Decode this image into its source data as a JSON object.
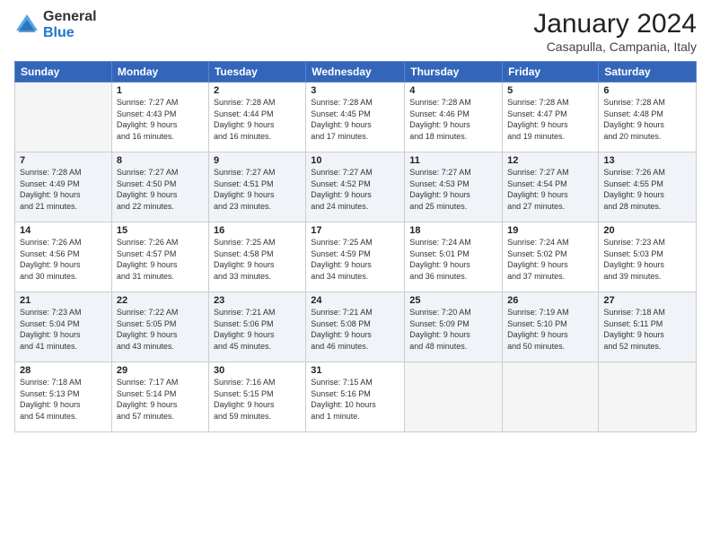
{
  "logo": {
    "general": "General",
    "blue": "Blue"
  },
  "header": {
    "month": "January 2024",
    "location": "Casapulla, Campania, Italy"
  },
  "weekdays": [
    "Sunday",
    "Monday",
    "Tuesday",
    "Wednesday",
    "Thursday",
    "Friday",
    "Saturday"
  ],
  "weeks": [
    [
      {
        "day": "",
        "sunrise": "",
        "sunset": "",
        "daylight": ""
      },
      {
        "day": "1",
        "sunrise": "Sunrise: 7:27 AM",
        "sunset": "Sunset: 4:43 PM",
        "daylight": "Daylight: 9 hours and 16 minutes."
      },
      {
        "day": "2",
        "sunrise": "Sunrise: 7:28 AM",
        "sunset": "Sunset: 4:44 PM",
        "daylight": "Daylight: 9 hours and 16 minutes."
      },
      {
        "day": "3",
        "sunrise": "Sunrise: 7:28 AM",
        "sunset": "Sunset: 4:45 PM",
        "daylight": "Daylight: 9 hours and 17 minutes."
      },
      {
        "day": "4",
        "sunrise": "Sunrise: 7:28 AM",
        "sunset": "Sunset: 4:46 PM",
        "daylight": "Daylight: 9 hours and 18 minutes."
      },
      {
        "day": "5",
        "sunrise": "Sunrise: 7:28 AM",
        "sunset": "Sunset: 4:47 PM",
        "daylight": "Daylight: 9 hours and 19 minutes."
      },
      {
        "day": "6",
        "sunrise": "Sunrise: 7:28 AM",
        "sunset": "Sunset: 4:48 PM",
        "daylight": "Daylight: 9 hours and 20 minutes."
      }
    ],
    [
      {
        "day": "7",
        "sunrise": "Sunrise: 7:28 AM",
        "sunset": "Sunset: 4:49 PM",
        "daylight": "Daylight: 9 hours and 21 minutes."
      },
      {
        "day": "8",
        "sunrise": "Sunrise: 7:27 AM",
        "sunset": "Sunset: 4:50 PM",
        "daylight": "Daylight: 9 hours and 22 minutes."
      },
      {
        "day": "9",
        "sunrise": "Sunrise: 7:27 AM",
        "sunset": "Sunset: 4:51 PM",
        "daylight": "Daylight: 9 hours and 23 minutes."
      },
      {
        "day": "10",
        "sunrise": "Sunrise: 7:27 AM",
        "sunset": "Sunset: 4:52 PM",
        "daylight": "Daylight: 9 hours and 24 minutes."
      },
      {
        "day": "11",
        "sunrise": "Sunrise: 7:27 AM",
        "sunset": "Sunset: 4:53 PM",
        "daylight": "Daylight: 9 hours and 25 minutes."
      },
      {
        "day": "12",
        "sunrise": "Sunrise: 7:27 AM",
        "sunset": "Sunset: 4:54 PM",
        "daylight": "Daylight: 9 hours and 27 minutes."
      },
      {
        "day": "13",
        "sunrise": "Sunrise: 7:26 AM",
        "sunset": "Sunset: 4:55 PM",
        "daylight": "Daylight: 9 hours and 28 minutes."
      }
    ],
    [
      {
        "day": "14",
        "sunrise": "Sunrise: 7:26 AM",
        "sunset": "Sunset: 4:56 PM",
        "daylight": "Daylight: 9 hours and 30 minutes."
      },
      {
        "day": "15",
        "sunrise": "Sunrise: 7:26 AM",
        "sunset": "Sunset: 4:57 PM",
        "daylight": "Daylight: 9 hours and 31 minutes."
      },
      {
        "day": "16",
        "sunrise": "Sunrise: 7:25 AM",
        "sunset": "Sunset: 4:58 PM",
        "daylight": "Daylight: 9 hours and 33 minutes."
      },
      {
        "day": "17",
        "sunrise": "Sunrise: 7:25 AM",
        "sunset": "Sunset: 4:59 PM",
        "daylight": "Daylight: 9 hours and 34 minutes."
      },
      {
        "day": "18",
        "sunrise": "Sunrise: 7:24 AM",
        "sunset": "Sunset: 5:01 PM",
        "daylight": "Daylight: 9 hours and 36 minutes."
      },
      {
        "day": "19",
        "sunrise": "Sunrise: 7:24 AM",
        "sunset": "Sunset: 5:02 PM",
        "daylight": "Daylight: 9 hours and 37 minutes."
      },
      {
        "day": "20",
        "sunrise": "Sunrise: 7:23 AM",
        "sunset": "Sunset: 5:03 PM",
        "daylight": "Daylight: 9 hours and 39 minutes."
      }
    ],
    [
      {
        "day": "21",
        "sunrise": "Sunrise: 7:23 AM",
        "sunset": "Sunset: 5:04 PM",
        "daylight": "Daylight: 9 hours and 41 minutes."
      },
      {
        "day": "22",
        "sunrise": "Sunrise: 7:22 AM",
        "sunset": "Sunset: 5:05 PM",
        "daylight": "Daylight: 9 hours and 43 minutes."
      },
      {
        "day": "23",
        "sunrise": "Sunrise: 7:21 AM",
        "sunset": "Sunset: 5:06 PM",
        "daylight": "Daylight: 9 hours and 45 minutes."
      },
      {
        "day": "24",
        "sunrise": "Sunrise: 7:21 AM",
        "sunset": "Sunset: 5:08 PM",
        "daylight": "Daylight: 9 hours and 46 minutes."
      },
      {
        "day": "25",
        "sunrise": "Sunrise: 7:20 AM",
        "sunset": "Sunset: 5:09 PM",
        "daylight": "Daylight: 9 hours and 48 minutes."
      },
      {
        "day": "26",
        "sunrise": "Sunrise: 7:19 AM",
        "sunset": "Sunset: 5:10 PM",
        "daylight": "Daylight: 9 hours and 50 minutes."
      },
      {
        "day": "27",
        "sunrise": "Sunrise: 7:18 AM",
        "sunset": "Sunset: 5:11 PM",
        "daylight": "Daylight: 9 hours and 52 minutes."
      }
    ],
    [
      {
        "day": "28",
        "sunrise": "Sunrise: 7:18 AM",
        "sunset": "Sunset: 5:13 PM",
        "daylight": "Daylight: 9 hours and 54 minutes."
      },
      {
        "day": "29",
        "sunrise": "Sunrise: 7:17 AM",
        "sunset": "Sunset: 5:14 PM",
        "daylight": "Daylight: 9 hours and 57 minutes."
      },
      {
        "day": "30",
        "sunrise": "Sunrise: 7:16 AM",
        "sunset": "Sunset: 5:15 PM",
        "daylight": "Daylight: 9 hours and 59 minutes."
      },
      {
        "day": "31",
        "sunrise": "Sunrise: 7:15 AM",
        "sunset": "Sunset: 5:16 PM",
        "daylight": "Daylight: 10 hours and 1 minute."
      },
      {
        "day": "",
        "sunrise": "",
        "sunset": "",
        "daylight": ""
      },
      {
        "day": "",
        "sunrise": "",
        "sunset": "",
        "daylight": ""
      },
      {
        "day": "",
        "sunrise": "",
        "sunset": "",
        "daylight": ""
      }
    ]
  ]
}
